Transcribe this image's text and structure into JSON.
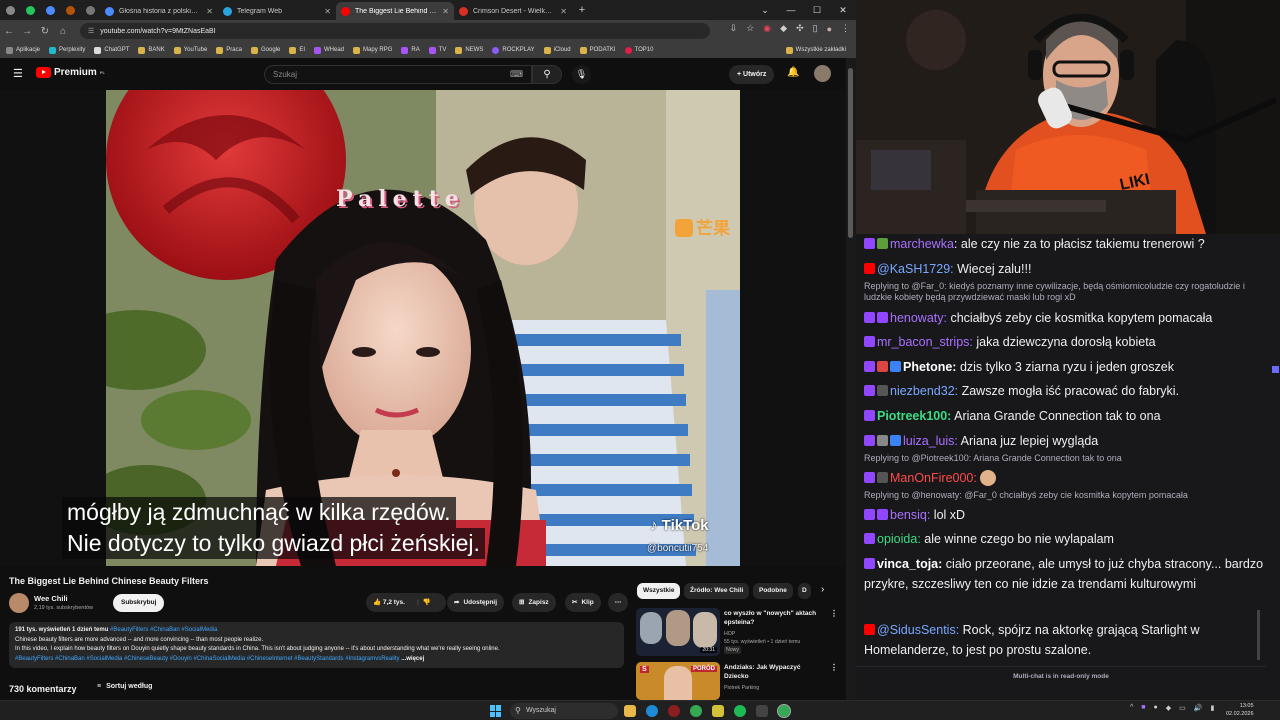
{
  "browser": {
    "tabs": [
      {
        "title": "Głośna historia z polskich socj",
        "active": false,
        "color": "#4a8cff"
      },
      {
        "title": "Telegram Web",
        "active": false,
        "color": "#2aa3e0"
      },
      {
        "title": "The Biggest Lie Behind Chi",
        "active": true,
        "color": "#ff0000"
      },
      {
        "title": "Crimson Desert - Wielka Encyk",
        "active": false,
        "color": "#d93025"
      }
    ],
    "url": "youtube.com/watch?v=9MtZNasEaBI",
    "bookmarks": [
      "Aplikacje",
      "Perplexity",
      "ChatGPT",
      "BANK",
      "YouTube",
      "Praca",
      "Google",
      "EI",
      "WHead",
      "Mapy RPG",
      "RA",
      "TV",
      "NEWS",
      "ROCKPLAY",
      "iCloud",
      "PODATKI",
      "TOP10"
    ],
    "bookmarks_all": "Wszystkie zakładki"
  },
  "youtube": {
    "logo": "Premium",
    "logo_region": "PL",
    "search_placeholder": "Szukaj",
    "create_label": "Utwórz",
    "video": {
      "subtitle_line1": "mógłby ją zdmuchnąć w kilka rzędów.",
      "subtitle_line2": "Nie dotyczy to tylko gwiazd płci żeńskiej.",
      "overlay_top": "Palette",
      "overlay_channel": "芒果",
      "tiktok": "TikTok",
      "tiktok_user": "@boncutii754"
    },
    "title": "The Biggest Lie Behind Chinese Beauty Filters",
    "channel": {
      "name": "Wee Chili",
      "subs": "2,19 tys. subskrybentów"
    },
    "subscribe_label": "Subskrybuj",
    "actions": {
      "likes": "7,2 tys.",
      "share": "Udostępnij",
      "save": "Zapisz",
      "clip": "Klip"
    },
    "description": {
      "meta": "191 tys. wyświetleń  1 dzień temu",
      "meta_tags": "#BeautyFilters #ChinaBan #SocialMedia",
      "line1": "Chinese beauty filters are more advanced -- and more convincing -- than most people realize.",
      "line2": "In this video, I explain how beauty filters on Douyin quietly shape beauty standards in China. This isn't about judging anyone -- it's about understanding what we're really seeing online.",
      "tags": "#BeautyFilters #ChinaBan #SocialMedia #ChineseBeauty #Douyin #ChinaSocialMedia #ChineseInternet  #BeautyStandards #InstagramvsReality",
      "more": "...więcej"
    },
    "comments_count": "730 komentarzy",
    "sort_label": "Sortuj według",
    "chips": [
      "Wszystkie",
      "Źródło: Wee Chili",
      "Podobne",
      "D"
    ],
    "recs": [
      {
        "title_line1": "co wyszło w \"nowych\" aktach",
        "title_line2": "epsteina?",
        "channel": "HOP",
        "meta": "55 tys. wyświetleń • 1 dzień temu",
        "badge": "Nowy",
        "duration": "20:31"
      },
      {
        "title_line1": "Andziaks: Jak Wypaczyć",
        "title_line2": "Dziecko",
        "channel": "Piotrek Parking",
        "thumb_text": "PORÓD"
      }
    ]
  },
  "chat": {
    "messages": [
      {
        "type": "msg",
        "user": "marchewka",
        "color": "#9b6bd6",
        "text": " ale czy nie za to płacisz takiemu trenerowi ?"
      },
      {
        "type": "msg",
        "user": "@KaSH1729:",
        "color": "#7aa7ff",
        "text": " Wiecej zalu!!!",
        "platform": "yt"
      },
      {
        "type": "reply",
        "text": "Replying to @Far_0: kiedyś poznamy inne cywilizacje, będą ośmiornicoludzie czy rogatoludzie i ludzkie kobiety będą przywdziewać maski lub rogi xD"
      },
      {
        "type": "msg",
        "user": "henowaty:",
        "color": "#9b6bd6",
        "text": " chciałbyś zeby cie kosmitka kopytem pomacała"
      },
      {
        "type": "msg",
        "user": "mr_bacon_strips:",
        "color": "#a970ff",
        "text": " jaka dziewczyna dorosłą kobieta"
      },
      {
        "type": "msg",
        "user": "Phetone:",
        "color": "#ffffff",
        "text": " dzis tylko 3 ziarna ryzu i jeden groszek"
      },
      {
        "type": "msg",
        "user": "niezbend32:",
        "color": "#7aa7ff",
        "text": " Zawsze mogła iść pracować do fabryki."
      },
      {
        "type": "msg",
        "user": "Piotreek100:",
        "color": "#3ddc84",
        "text": " Ariana Grande Connection tak to ona"
      },
      {
        "type": "msg",
        "user": "luiza_luis:",
        "color": "#a970ff",
        "text": " Ariana juz lepiej wygląda"
      },
      {
        "type": "reply",
        "text": "Replying to @Piotreek100: Ariana Grande Connection tak to ona"
      },
      {
        "type": "msg",
        "user": "ManOnFire000:",
        "color": "#ff4a4a",
        "text": ""
      },
      {
        "type": "reply",
        "text": "Replying to @henowaty: @Far_0 chciałbyś zeby cie kosmitka kopytem pomacała"
      },
      {
        "type": "msg",
        "user": "bensiq:",
        "color": "#a970ff",
        "text": " lol xD"
      },
      {
        "type": "msg",
        "user": "opioida:",
        "color": "#3ddc84",
        "text": " ale winne czego bo nie wylapalam"
      },
      {
        "type": "msg",
        "user": "vinca_toja:",
        "color": "#ffffff",
        "text": " ciało przeorane, ale umysł to już chyba stracony... bardzo przykre, szczesliwy ten co nie idzie za trendami kulturowymi"
      },
      {
        "type": "msg",
        "user": "@SidusSentis:",
        "color": "#7aa7ff",
        "text": " Rock, spójrz na aktorkę grającą Starlight w Homelanderze, to jest po prostu szalone.",
        "platform": "yt"
      }
    ],
    "footer": "Multi-chat is in read-only mode"
  },
  "taskbar": {
    "search": "Wyszukaj",
    "time": "13:05",
    "date": "02.02.2026"
  }
}
